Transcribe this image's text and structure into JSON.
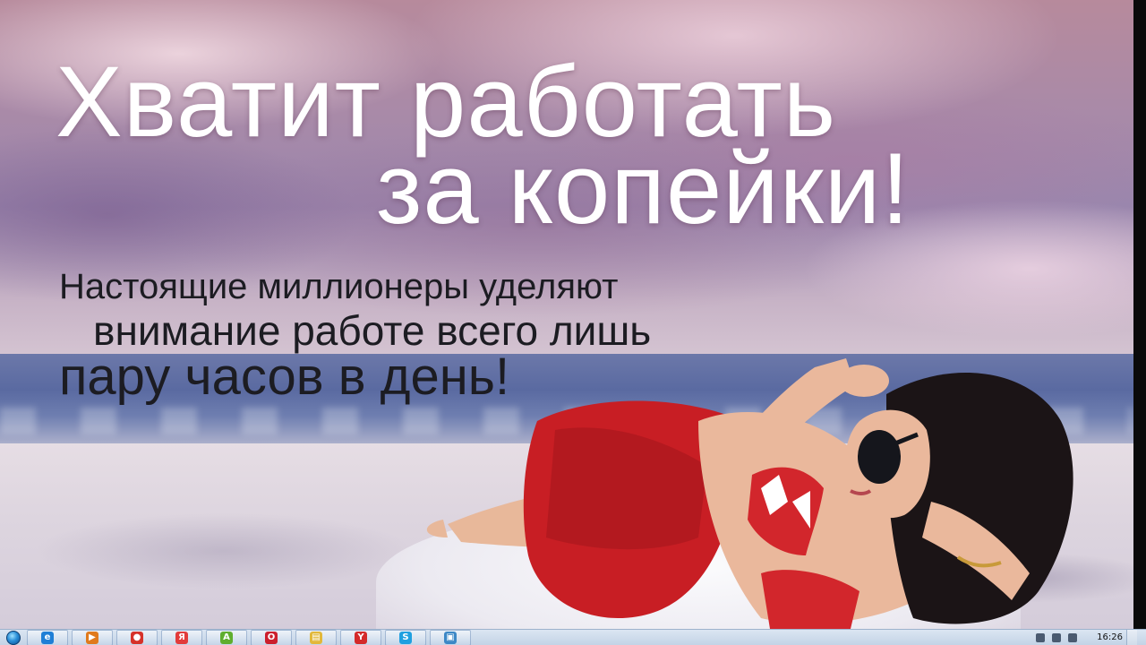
{
  "ad": {
    "headline_line1": "Хватит работать",
    "headline_line2": "за копейки!",
    "sub_line1": "Настоящие миллионеры уделяют",
    "sub_line2": "внимание работе всего лишь",
    "sub_line3": "пару часов в день!"
  },
  "taskbar": {
    "items": [
      {
        "name": "internet-explorer",
        "glyph": "e",
        "color": "#1f7fd6"
      },
      {
        "name": "media-player",
        "glyph": "▶",
        "color": "#e07a1c"
      },
      {
        "name": "chrome",
        "glyph": "●",
        "color": "#d6322a"
      },
      {
        "name": "yandex-app",
        "glyph": "Я",
        "color": "#e23b3b"
      },
      {
        "name": "android-app",
        "glyph": "A",
        "color": "#5fae2e"
      },
      {
        "name": "opera",
        "glyph": "O",
        "color": "#cc1f2d"
      },
      {
        "name": "file-explorer",
        "glyph": "▤",
        "color": "#e2b83a"
      },
      {
        "name": "yandex-browser",
        "glyph": "Y",
        "color": "#d42a2a"
      },
      {
        "name": "skype",
        "glyph": "S",
        "color": "#1fa0e0"
      },
      {
        "name": "image-viewer",
        "glyph": "▣",
        "color": "#3c88c6"
      }
    ],
    "clock": "16:26"
  }
}
